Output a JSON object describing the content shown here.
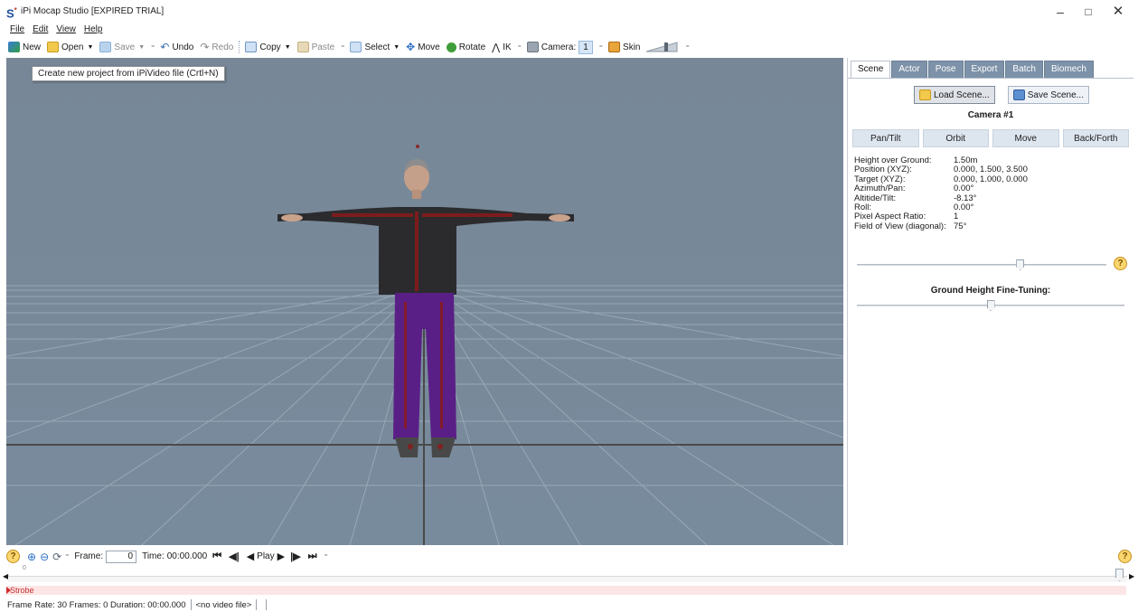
{
  "window": {
    "logo": "S",
    "title": "iPi Mocap Studio [EXPIRED TRIAL]",
    "controls": {
      "minimize": "–",
      "maximize": "□",
      "close": "✕"
    }
  },
  "menu": [
    "File",
    "Edit",
    "View",
    "Help"
  ],
  "toolbar": {
    "new": "New",
    "open": "Open",
    "save": "Save",
    "undo": "Undo",
    "redo": "Redo",
    "copy": "Copy",
    "paste": "Paste",
    "select": "Select",
    "move": "Move",
    "rotate": "Rotate",
    "ik": "IK",
    "camera_label": "Camera:",
    "camera_value": "1",
    "skin": "Skin"
  },
  "tooltip": "Create new project from iPiVideo file (Crtl+N)",
  "panel": {
    "tabs": [
      "Scene",
      "Actor",
      "Pose",
      "Export",
      "Batch",
      "Biomech"
    ],
    "active_tab": "Scene",
    "load_scene": "Load Scene...",
    "save_scene": "Save Scene...",
    "camera_title": "Camera #1",
    "nav_buttons": [
      "Pan/Tilt",
      "Orbit",
      "Move",
      "Back/Forth"
    ],
    "properties": [
      {
        "label": "Height over Ground:",
        "value": "1.50m"
      },
      {
        "label": "Position (XYZ):",
        "value": "0.000, 1.500, 3.500"
      },
      {
        "label": "Target (XYZ):",
        "value": "0.000, 1.000, 0.000"
      },
      {
        "label": "Azimuth/Pan:",
        "value": "0.00°"
      },
      {
        "label": "Altitide/Tilt:",
        "value": "-8.13°"
      },
      {
        "label": "Roll:",
        "value": "0.00°"
      },
      {
        "label": "Pixel Aspect Ratio:",
        "value": "1"
      },
      {
        "label": "Field of View (diagonal):",
        "value": "75°"
      }
    ],
    "fov_slider": 0.66,
    "ground_title": "Ground Height Fine-Tuning:",
    "ground_slider": 0.5,
    "help": "?"
  },
  "playback": {
    "frame_label": "Frame:",
    "frame_value": "0",
    "time_label": "Time:",
    "time_value": "00:00.000",
    "play": "Play",
    "help": "?"
  },
  "timeline": {
    "zero_label": "0",
    "strobe_label": "Strobe",
    "position": 0.99
  },
  "status": {
    "frame_rate": "Frame Rate: 30",
    "frames": "Frames: 0",
    "duration": "Duration: 00:00.000",
    "video_file": "<no video file>"
  },
  "colors": {
    "viewport_bg": "#778797",
    "tab_inactive": "#7d92a8",
    "shirt": "#2b2b2e",
    "pants": "#5a1f86",
    "strobe_bg": "#fde5e5"
  }
}
